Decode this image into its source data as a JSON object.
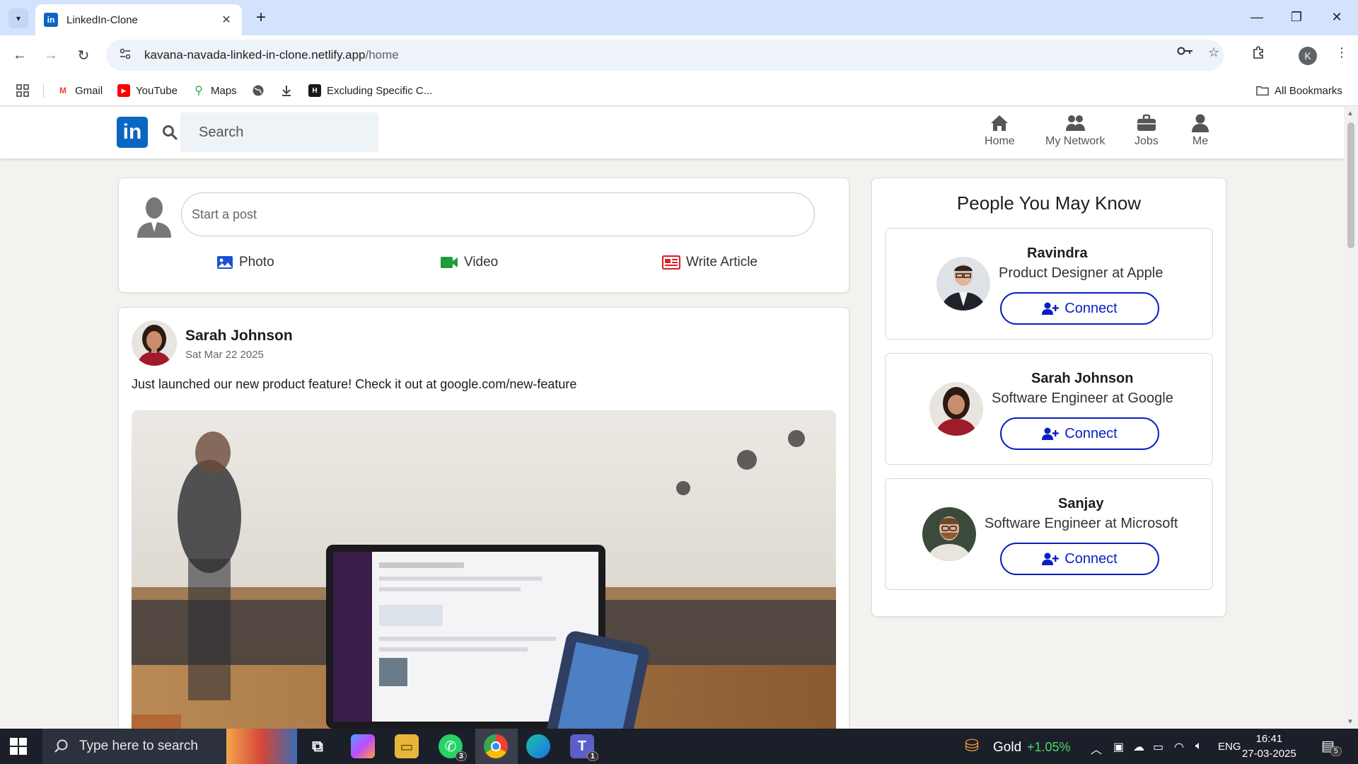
{
  "browser": {
    "tab_title": "LinkedIn-Clone",
    "tab_favicon": "in",
    "url_host": "kavana-navada-linked-in-clone.netlify.app",
    "url_path": "/home",
    "profile_initial": "K",
    "bookmarks": [
      "Gmail",
      "YouTube",
      "Maps",
      "Excluding Specific C..."
    ],
    "all_bookmarks_label": "All Bookmarks"
  },
  "navbar": {
    "logo": "in",
    "search_placeholder": "Search",
    "items": [
      "Home",
      "My Network",
      "Jobs",
      "Me"
    ]
  },
  "composer": {
    "placeholder": "Start a post",
    "actions": [
      "Photo",
      "Video",
      "Write Article"
    ]
  },
  "post": {
    "author": "Sarah Johnson",
    "date": "Sat Mar 22 2025",
    "text": "Just launched our new product feature! Check it out at google.com/new-feature"
  },
  "people": {
    "title": "People You May Know",
    "list": [
      {
        "name": "Ravindra",
        "role": "Product Designer at Apple",
        "button": "Connect"
      },
      {
        "name": "Sarah Johnson",
        "role": "Software Engineer at Google",
        "button": "Connect"
      },
      {
        "name": "Sanjay",
        "role": "Software Engineer at Microsoft",
        "button": "Connect"
      }
    ]
  },
  "taskbar": {
    "search_placeholder": "Type here to search",
    "whatsapp_badge": "3",
    "teams_badge": "1",
    "stock_name": "Gold",
    "stock_change": "+1.05%",
    "language": "ENG",
    "time": "16:41",
    "date": "27-03-2025",
    "notification_count": "5"
  },
  "colors": {
    "linkedin_blue": "#0a66c2",
    "connect_blue": "#0a1fc2",
    "stock_green": "#4cd964"
  }
}
